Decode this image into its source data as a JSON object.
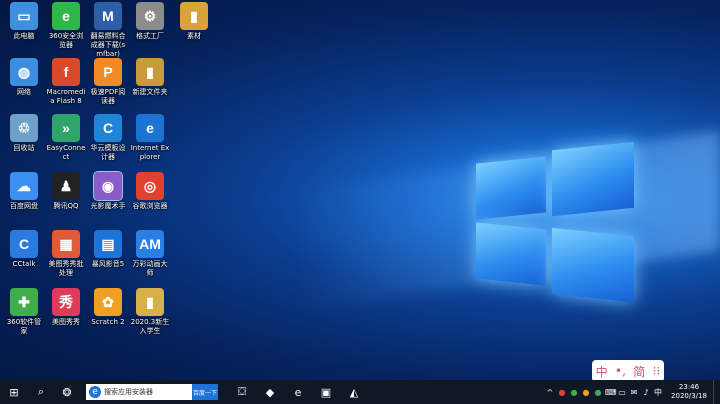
{
  "desktop": {
    "icons": [
      {
        "label": "此电脑",
        "glyph": "▭",
        "color": "#3f8fe0"
      },
      {
        "label": "360安全浏览器",
        "glyph": "e",
        "color": "#2fb84a"
      },
      {
        "label": "翻易燃料合成器下载(smfbar)",
        "glyph": "M",
        "color": "#2c5fa8"
      },
      {
        "label": "格式工厂",
        "glyph": "⚙",
        "color": "#8c8c8c"
      },
      {
        "label": "素材",
        "glyph": "▮",
        "color": "#d9a23b"
      },
      {
        "label": "网络",
        "glyph": "◍",
        "color": "#3d8de0"
      },
      {
        "label": "Macromedia Flash 8",
        "glyph": "f",
        "color": "#d84a2b"
      },
      {
        "label": "极速PDF阅读器",
        "glyph": "P",
        "color": "#f08a24"
      },
      {
        "label": "新建文件夹",
        "glyph": "▮",
        "color": "#c99a3a"
      },
      {
        "label": "回收站",
        "glyph": "♲",
        "color": "#6ea0c8"
      },
      {
        "label": "EasyConnect",
        "glyph": "»",
        "color": "#2fa56b"
      },
      {
        "label": "华云模板设计器",
        "glyph": "C",
        "color": "#1f86d6"
      },
      {
        "label": "Internet Explorer",
        "glyph": "e",
        "color": "#1d73d4"
      },
      {
        "label": "百度网盘",
        "glyph": "☁",
        "color": "#3b8ff0"
      },
      {
        "label": "腾讯QQ",
        "glyph": "♟",
        "color": "#222222"
      },
      {
        "label": "光影魔术手",
        "glyph": "◉",
        "color": "#8a5cc7"
      },
      {
        "label": "谷歌浏览器",
        "glyph": "◎",
        "color": "#e0402e"
      },
      {
        "label": "CCtalk",
        "glyph": "C",
        "color": "#2a7be0"
      },
      {
        "label": "美图秀秀批处理",
        "glyph": "▦",
        "color": "#e05a3a"
      },
      {
        "label": "暴风影音5",
        "glyph": "▤",
        "color": "#1e73d8"
      },
      {
        "label": "万彩动画大师",
        "glyph": "AM",
        "color": "#2a7fe6"
      },
      {
        "label": "360软件管家",
        "glyph": "✚",
        "color": "#3fae4a"
      },
      {
        "label": "美图秀秀",
        "glyph": "秀",
        "color": "#e03a5a"
      },
      {
        "label": "Scratch 2",
        "glyph": "✿",
        "color": "#f0a020"
      },
      {
        "label": "2020.3新生入学生",
        "glyph": "▮",
        "color": "#d8b04a"
      }
    ]
  },
  "ime": {
    "lang": "中",
    "punct": "•,",
    "mode": "简",
    "options": "⁝⁝"
  },
  "taskbar": {
    "start_icon": "⊞",
    "search_icon": "⌕",
    "task_view_icon": "❂",
    "search_placeholder": "搜索应用安装器",
    "search_button": "百度一下",
    "pinned": [
      {
        "name": "store",
        "glyph": "⛋"
      },
      {
        "name": "app2",
        "glyph": "◆"
      },
      {
        "name": "app3",
        "glyph": "e"
      },
      {
        "name": "app4",
        "glyph": "▣"
      },
      {
        "name": "app5",
        "glyph": "◭"
      }
    ],
    "tray": [
      "^",
      "●",
      "●",
      "●",
      "●",
      "⌨",
      "▭",
      "✉",
      "♪",
      "中"
    ],
    "time": "23:46",
    "date": "2020/3/18"
  }
}
